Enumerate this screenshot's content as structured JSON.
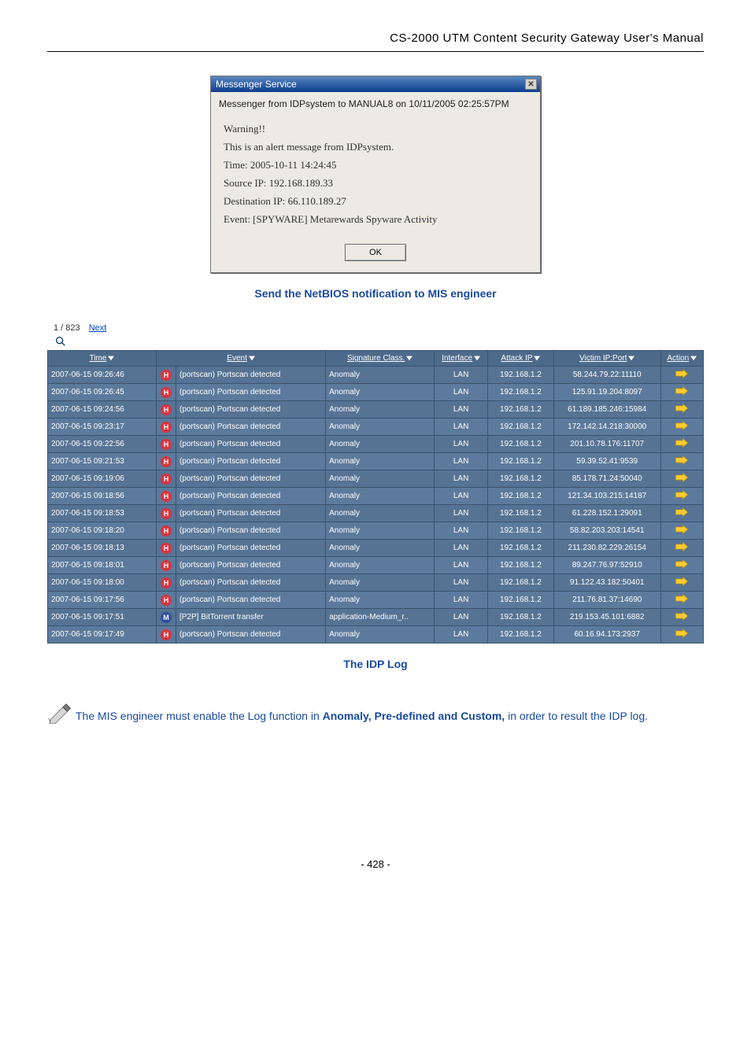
{
  "header": {
    "title": "CS-2000 UTM Content Security Gateway User's Manual"
  },
  "dialog": {
    "title": "Messenger Service",
    "subhead": "Messenger from IDPsystem to MANUAL8 on 10/11/2005 02:25:57PM",
    "lines": [
      "Warning!!",
      "This is an alert message from IDPsystem.",
      "Time: 2005-10-11 14:24:45",
      "Source IP: 192.168.189.33",
      "Destination IP: 66.110.189.27",
      "Event: [SPYWARE] Metarewards Spyware Activity"
    ],
    "ok": "OK"
  },
  "caption1": "Send the NetBIOS notification to MIS engineer",
  "pager": {
    "counts": "1 / 823",
    "next": "Next"
  },
  "columns": {
    "time": "Time",
    "event": "Event",
    "sig": "Signature Class.",
    "iface": "Interface",
    "atk": "Attack IP",
    "vic": "Victim IP:Port",
    "act": "Action"
  },
  "rows": [
    {
      "time": "2007-06-15 09:26:46",
      "risk": "H",
      "event": "(portscan) Portscan detected",
      "sig": "Anomaly",
      "iface": "LAN",
      "atk": "192.168.1.2",
      "vic": "58.244.79.22:11110"
    },
    {
      "time": "2007-06-15 09:26:45",
      "risk": "H",
      "event": "(portscan) Portscan detected",
      "sig": "Anomaly",
      "iface": "LAN",
      "atk": "192.168.1.2",
      "vic": "125.91.19.204:8097"
    },
    {
      "time": "2007-06-15 09:24:56",
      "risk": "H",
      "event": "(portscan) Portscan detected",
      "sig": "Anomaly",
      "iface": "LAN",
      "atk": "192.168.1.2",
      "vic": "61.189.185.246:15984"
    },
    {
      "time": "2007-06-15 09:23:17",
      "risk": "H",
      "event": "(portscan) Portscan detected",
      "sig": "Anomaly",
      "iface": "LAN",
      "atk": "192.168.1.2",
      "vic": "172.142.14.218:30000"
    },
    {
      "time": "2007-06-15 09:22:56",
      "risk": "H",
      "event": "(portscan) Portscan detected",
      "sig": "Anomaly",
      "iface": "LAN",
      "atk": "192.168.1.2",
      "vic": "201.10.78.176:11707"
    },
    {
      "time": "2007-06-15 09:21:53",
      "risk": "H",
      "event": "(portscan) Portscan detected",
      "sig": "Anomaly",
      "iface": "LAN",
      "atk": "192.168.1.2",
      "vic": "59.39.52.41:9539"
    },
    {
      "time": "2007-06-15 09:19:06",
      "risk": "H",
      "event": "(portscan) Portscan detected",
      "sig": "Anomaly",
      "iface": "LAN",
      "atk": "192.168.1.2",
      "vic": "85.178.71.24:50040"
    },
    {
      "time": "2007-06-15 09:18:56",
      "risk": "H",
      "event": "(portscan) Portscan detected",
      "sig": "Anomaly",
      "iface": "LAN",
      "atk": "192.168.1.2",
      "vic": "121.34.103.215:14187"
    },
    {
      "time": "2007-06-15 09:18:53",
      "risk": "H",
      "event": "(portscan) Portscan detected",
      "sig": "Anomaly",
      "iface": "LAN",
      "atk": "192.168.1.2",
      "vic": "61.228.152.1:29091"
    },
    {
      "time": "2007-06-15 09:18:20",
      "risk": "H",
      "event": "(portscan) Portscan detected",
      "sig": "Anomaly",
      "iface": "LAN",
      "atk": "192.168.1.2",
      "vic": "58.82.203.203:14541"
    },
    {
      "time": "2007-06-15 09:18:13",
      "risk": "H",
      "event": "(portscan) Portscan detected",
      "sig": "Anomaly",
      "iface": "LAN",
      "atk": "192.168.1.2",
      "vic": "211.230.82.229:26154"
    },
    {
      "time": "2007-06-15 09:18:01",
      "risk": "H",
      "event": "(portscan) Portscan detected",
      "sig": "Anomaly",
      "iface": "LAN",
      "atk": "192.168.1.2",
      "vic": "89.247.76.97:52910"
    },
    {
      "time": "2007-06-15 09:18:00",
      "risk": "H",
      "event": "(portscan) Portscan detected",
      "sig": "Anomaly",
      "iface": "LAN",
      "atk": "192.168.1.2",
      "vic": "91.122.43.182:50401"
    },
    {
      "time": "2007-06-15 09:17:56",
      "risk": "H",
      "event": "(portscan) Portscan detected",
      "sig": "Anomaly",
      "iface": "LAN",
      "atk": "192.168.1.2",
      "vic": "211.76.81.37:14690"
    },
    {
      "time": "2007-06-15 09:17:51",
      "risk": "M",
      "event": "[P2P] BitTorrent transfer",
      "sig": "application-Medium_r..",
      "iface": "LAN",
      "atk": "192.168.1.2",
      "vic": "219.153.45.101:6882"
    },
    {
      "time": "2007-06-15 09:17:49",
      "risk": "H",
      "event": "(portscan) Portscan detected",
      "sig": "Anomaly",
      "iface": "LAN",
      "atk": "192.168.1.2",
      "vic": "60.16.94.173:2937"
    }
  ],
  "caption2": "The IDP Log",
  "note": {
    "text_a": "The MIS engineer must enable the Log function in ",
    "bold": "Anomaly, Pre-defined and Custom,",
    "text_b": " in order to result the IDP log."
  },
  "page_number": "- 428 -"
}
